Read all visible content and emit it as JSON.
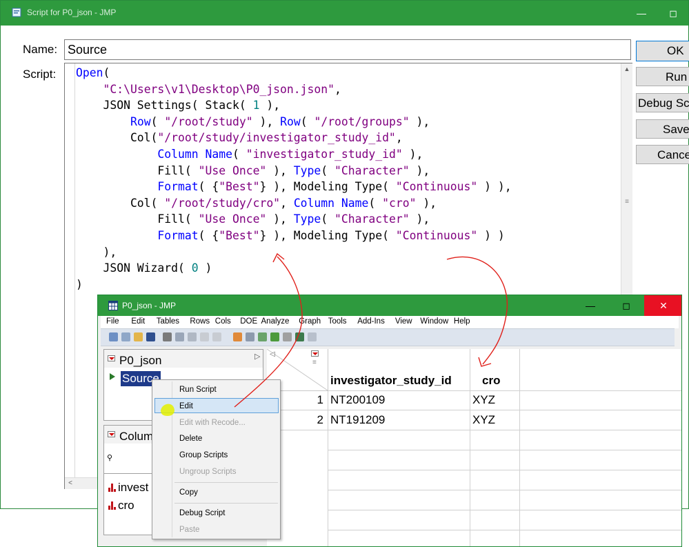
{
  "script_window": {
    "title": "Script for P0_json - JMP",
    "name_label": "Name:",
    "name_value": "Source",
    "script_label": "Script:",
    "buttons": {
      "ok": "OK",
      "run": "Run",
      "debug": "Debug Sc",
      "save": "Save",
      "cancel": "Cance"
    },
    "code_lines": [
      "Open(",
      "    \"C:\\Users\\v1\\Desktop\\P0_json.json\",",
      "    JSON Settings( Stack( 1 ),",
      "        Row( \"/root/study\" ), Row( \"/root/groups\" ),",
      "        Col(\"/root/study/investigator_study_id\",",
      "            Column Name( \"investigator_study_id\" ),",
      "            Fill( \"Use Once\" ), Type( \"Character\" ),",
      "            Format( {\"Best\"} ), Modeling Type( \"Continuous\" ) ),",
      "        Col( \"/root/study/cro\", Column Name( \"cro\" ),",
      "            Fill( \"Use Once\" ), Type( \"Character\" ),",
      "            Format( {\"Best\"} ), Modeling Type( \"Continuous\" ) )",
      "    ),",
      "    JSON Wizard( 0 )",
      ")"
    ]
  },
  "data_window": {
    "title": "P0_json - JMP",
    "menu": [
      "File",
      "Edit",
      "Tables",
      "Rows",
      "Cols",
      "DOE",
      "Analyze",
      "Graph",
      "Tools",
      "Add-Ins",
      "View",
      "Window",
      "Help"
    ],
    "table_panel": {
      "title": "P0_json",
      "script_item": "Source"
    },
    "columns_panel": {
      "title": "Colum",
      "search_glyph": "⚲"
    },
    "column_list": [
      "invest",
      "cro"
    ],
    "grid": {
      "headers": [
        "investigator_study_id",
        "cro"
      ],
      "rows": [
        {
          "num": "1",
          "investigator_study_id": "NT200109",
          "cro": "XYZ"
        },
        {
          "num": "2",
          "investigator_study_id": "NT191209",
          "cro": "XYZ"
        }
      ]
    }
  },
  "context_menu": {
    "items": [
      {
        "label": "Run Script",
        "enabled": true
      },
      {
        "label": "Edit",
        "enabled": true,
        "highlighted": true
      },
      {
        "label": "Edit with Recode...",
        "enabled": false
      },
      {
        "label": "Delete",
        "enabled": true
      },
      {
        "label": "Group Scripts",
        "enabled": true
      },
      {
        "label": "Ungroup Scripts",
        "enabled": false
      },
      {
        "label": "Copy",
        "enabled": true
      },
      {
        "label": "Debug Script",
        "enabled": true
      },
      {
        "label": "Paste",
        "enabled": false
      }
    ]
  },
  "colors": {
    "title_bar": "#2e9a3e",
    "close_button": "#e81123",
    "annotation": "#e0201a",
    "highlight_marker": "#e4f000",
    "keyword": "#0000ff",
    "string": "#800080",
    "number": "#008080"
  }
}
